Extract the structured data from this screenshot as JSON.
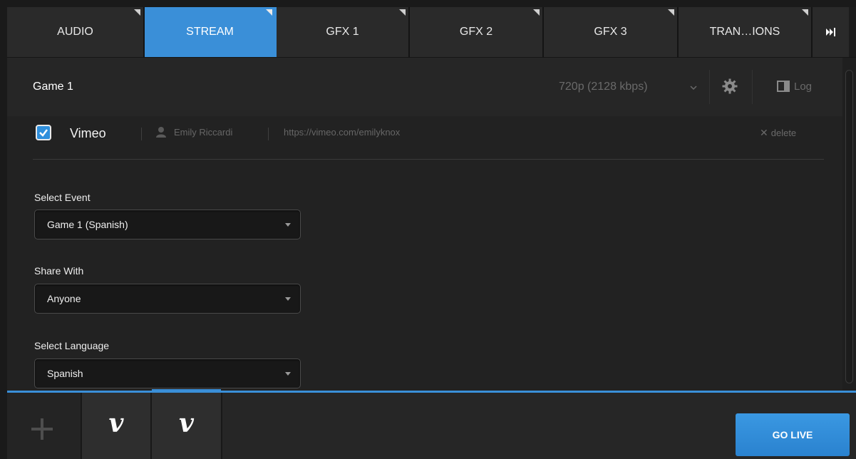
{
  "tabs": [
    {
      "label": "AUDIO",
      "active": false
    },
    {
      "label": "STREAM",
      "active": true
    },
    {
      "label": "GFX 1",
      "active": false
    },
    {
      "label": "GFX 2",
      "active": false
    },
    {
      "label": "GFX 3",
      "active": false
    },
    {
      "label": "TRAN…IONS",
      "active": false
    }
  ],
  "header": {
    "title": "Game 1",
    "resolution": "720p (2128 kbps)",
    "log_label": "Log"
  },
  "service": {
    "checked": true,
    "name": "Vimeo",
    "user": "Emily Riccardi",
    "url": "https://vimeo.com/emilyknox",
    "delete_label": "delete"
  },
  "fields": {
    "event": {
      "label": "Select Event",
      "value": "Game 1 (Spanish)"
    },
    "share": {
      "label": "Share With",
      "value": "Anyone"
    },
    "language": {
      "label": "Select Language",
      "value": "Spanish"
    }
  },
  "bottom": {
    "destinations": [
      "v",
      "v"
    ],
    "go_live_label": "GO LIVE"
  },
  "icons": [
    "chevron-down-icon",
    "gear-icon",
    "log-panel-icon",
    "checkmark-icon",
    "user-icon",
    "close-icon",
    "plus-icon",
    "skip-forward-icon",
    "vimeo-logo-icon"
  ],
  "colors": {
    "accent": "#3a8fd8",
    "background": "#222222"
  }
}
